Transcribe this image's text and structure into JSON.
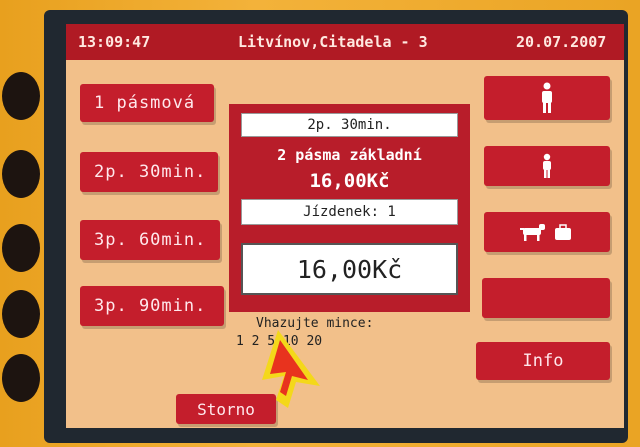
{
  "header": {
    "time": "13:09:47",
    "location": "Litvínov,Citadela - 3",
    "date": "20.07.2007"
  },
  "tariff_buttons": [
    {
      "label": "1 pásmová"
    },
    {
      "label": "2p. 30min."
    },
    {
      "label": "3p. 60min."
    },
    {
      "label": "3p. 90min."
    }
  ],
  "ticket": {
    "selected_tariff": "2p. 30min.",
    "description": "2 pásma základní",
    "unit_price": "16,00Kč",
    "count_label": "Jízdenek: 1",
    "total": "16,00Kč"
  },
  "coins": {
    "label": "Vhazujte mince:",
    "values": "1 2 5 10 20"
  },
  "cancel_label": "Storno",
  "info_label": "Info",
  "colors": {
    "button": "#c41e2c",
    "screen": "#f2c08a",
    "header": "#b01a24",
    "casing": "#f0a020"
  }
}
